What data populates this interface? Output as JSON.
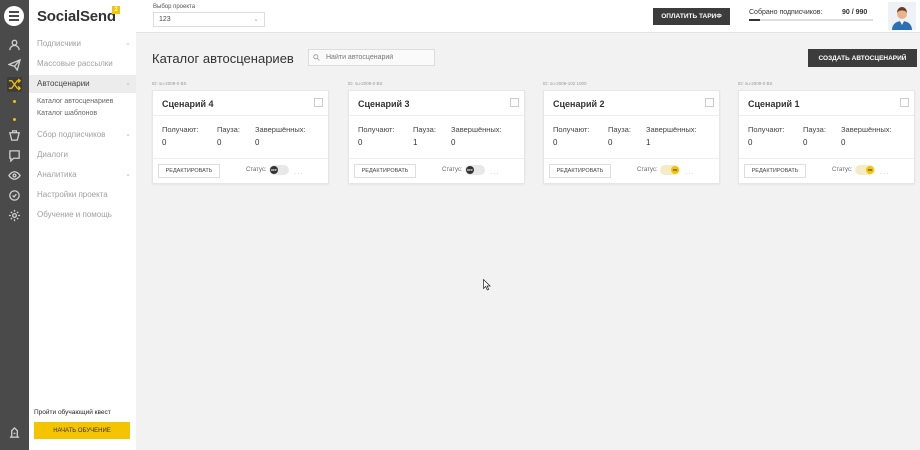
{
  "brand": {
    "name": "SocialSend",
    "badge": "2"
  },
  "rail_icons": [
    "contacts-icon",
    "broadcast-icon",
    "autoscenario-icon",
    "dot",
    "dot",
    "collect-icon",
    "dialog-icon",
    "analytics-icon",
    "settings-icon",
    "help-icon"
  ],
  "sidebar": {
    "items": [
      {
        "label": "Подписчики",
        "chevron": "⌄"
      },
      {
        "label": "Массовые рассылки",
        "chevron": ""
      },
      {
        "label": "Автосценарии",
        "chevron": "⌄"
      },
      {
        "label": "Сбор подписчиков",
        "chevron": "⌄"
      },
      {
        "label": "Диалоги",
        "chevron": ""
      },
      {
        "label": "Аналитика",
        "chevron": "⌄"
      },
      {
        "label": "Настройки проекта",
        "chevron": ""
      },
      {
        "label": "Обучение и помощь",
        "chevron": ""
      }
    ],
    "subitems": [
      "Каталог автосценариев",
      "Каталог шаблонов"
    ],
    "quest_text": "Пройти обучающий квест",
    "quest_button": "Начать обучение"
  },
  "topbar": {
    "project_label": "Выбор проекта",
    "project_value": "123",
    "pay_button": "Оплатить тариф",
    "subscribers_label": "Собрано подписчиков:",
    "subscribers_count": "90 / 990",
    "subscribers_progress": 0.091
  },
  "main": {
    "title": "Каталог автосценариев",
    "search_placeholder": "Найти автосценарий",
    "create_button": "Создать автосценарий"
  },
  "card_labels": {
    "received": "Получают:",
    "paused": "Пауза:",
    "completed": "Завершённых:",
    "edit": "Редактировать",
    "status": "Статус:",
    "more": "..."
  },
  "cards": [
    {
      "id": "ID: su-2009-0 BS",
      "title": "Сценарий 4",
      "received": "0",
      "paused": "0",
      "completed": "0",
      "status": "off",
      "status_text": "OFF"
    },
    {
      "id": "ID: su-2009-0 BS",
      "title": "Сценарий 3",
      "received": "0",
      "paused": "1",
      "completed": "0",
      "status": "off",
      "status_text": "OFF"
    },
    {
      "id": "ID: su-2009-102 1000",
      "title": "Сценарий 2",
      "received": "0",
      "paused": "0",
      "completed": "1",
      "status": "on",
      "status_text": "ON"
    },
    {
      "id": "ID: su-2009-0 BS",
      "title": "Сценарий 1",
      "received": "0",
      "paused": "0",
      "completed": "0",
      "status": "on",
      "status_text": "ON"
    }
  ]
}
